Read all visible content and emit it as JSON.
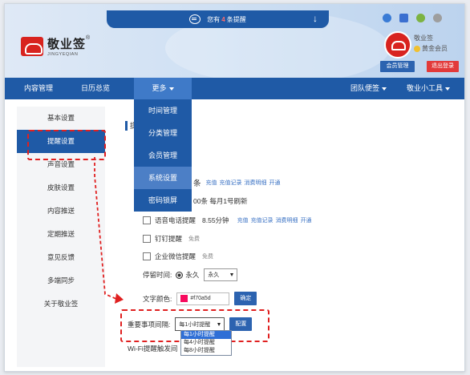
{
  "header": {
    "notice": {
      "prefix": "您有",
      "count": "4",
      "suffix": "条提醒"
    },
    "logo": {
      "name": "敬业签",
      "reg": "®",
      "en": "JINGYEQIAN"
    },
    "user": {
      "name": "敬业签",
      "level": "黄金会员"
    },
    "buttons": {
      "member": "会员管理",
      "logout": "退出登录"
    }
  },
  "nav": {
    "content": "内容管理",
    "calendar": "日历总览",
    "more": "更多",
    "team": "团队便签",
    "tools": "敬业小工具"
  },
  "dropdown": [
    "时间管理",
    "分类管理",
    "会员管理",
    "系统设置",
    "密码锁屏"
  ],
  "sidebar": [
    "基本设置",
    "提醒设置",
    "声音设置",
    "皮肤设置",
    "内容推送",
    "定期推送",
    "意见反馈",
    "多端同步",
    "关于敬业签"
  ],
  "content": {
    "title_partial": "提",
    "sms_tail": "条",
    "links1": [
      "充值",
      "充值记录",
      "消费明细",
      "开通"
    ],
    "quota_tail": "00条 每月1号刷新",
    "voice": {
      "label": "语音电话提醒",
      "value": "8.55分钟",
      "links": [
        "充值",
        "充值记录",
        "消费明细",
        "开通"
      ]
    },
    "dingtalk": {
      "label": "钉钉提醒",
      "free": "免费"
    },
    "wechat": {
      "label": "企业微信提醒",
      "free": "免费"
    },
    "stay": {
      "label": "停留时间:",
      "radio": "永久",
      "select": "永久"
    },
    "color": {
      "label": "文字颜色:",
      "value": "#f70a5d",
      "button": "确定"
    },
    "important": {
      "label": "重要事项间隔:",
      "select": "每1小时提醒",
      "button": "配置"
    },
    "options": [
      "每1小时提醒",
      "每4小时提醒",
      "每8小时提醒"
    ],
    "wifi": "Wi-Fi提醒触发间"
  },
  "colors": {
    "primary": "#1f5aa6",
    "danger": "#e23a3a",
    "accent": "#f70a5d"
  }
}
